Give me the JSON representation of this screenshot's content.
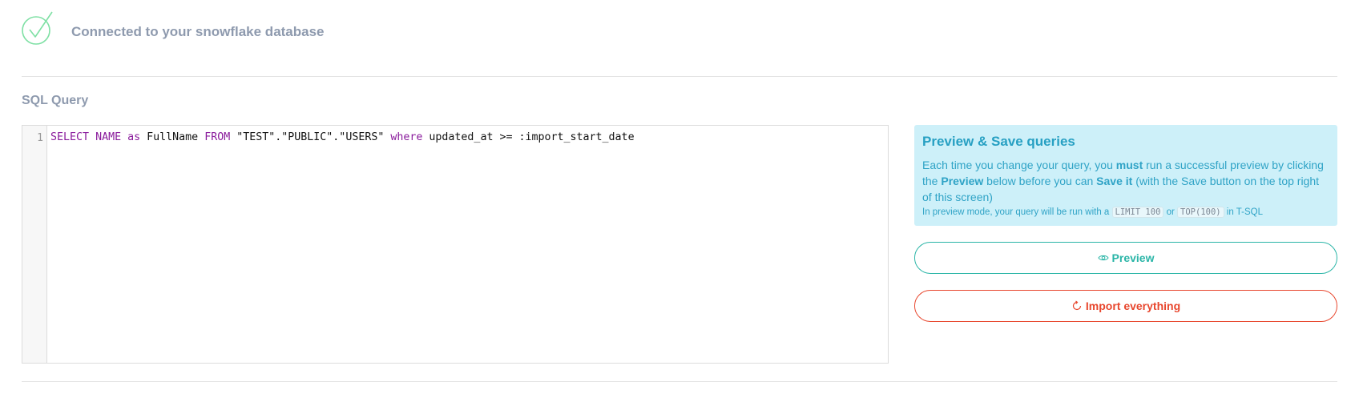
{
  "status": {
    "icon": "check-circle-icon",
    "text": "Connected to your snowflake database",
    "color": "#8e9aae",
    "icon_color": "#7ee0a4"
  },
  "section": {
    "title": "SQL Query"
  },
  "editor": {
    "line_number": "1",
    "tokens": {
      "t1": "SELECT",
      "t2": " ",
      "t3": "NAME",
      "t4": " ",
      "t5": "as",
      "t6": " FullName ",
      "t7": "FROM",
      "t8": " \"TEST\".\"PUBLIC\".\"USERS\" ",
      "t9": "where",
      "t10": " updated_at >= :import_start_date"
    }
  },
  "info": {
    "title": "Preview & Save queries",
    "p1": "Each time you change your query, you ",
    "p1_bold": "must",
    "p2": " run a successful preview by clicking the ",
    "p2_bold": "Preview",
    "p3": " below before you can ",
    "p3_bold": "Save it",
    "p4": " (with the Save button on the top right of this screen)",
    "sub1": "In preview mode, your query will be run with a ",
    "code1": "LIMIT 100",
    "sub2": " or ",
    "code2": "TOP(100)",
    "sub3": " in T-SQL"
  },
  "buttons": {
    "preview": {
      "label": "Preview",
      "icon": "eye-icon",
      "color": "#2ab5a7"
    },
    "import": {
      "label": "Import everything",
      "icon": "refresh-icon",
      "color": "#e8472e"
    }
  }
}
